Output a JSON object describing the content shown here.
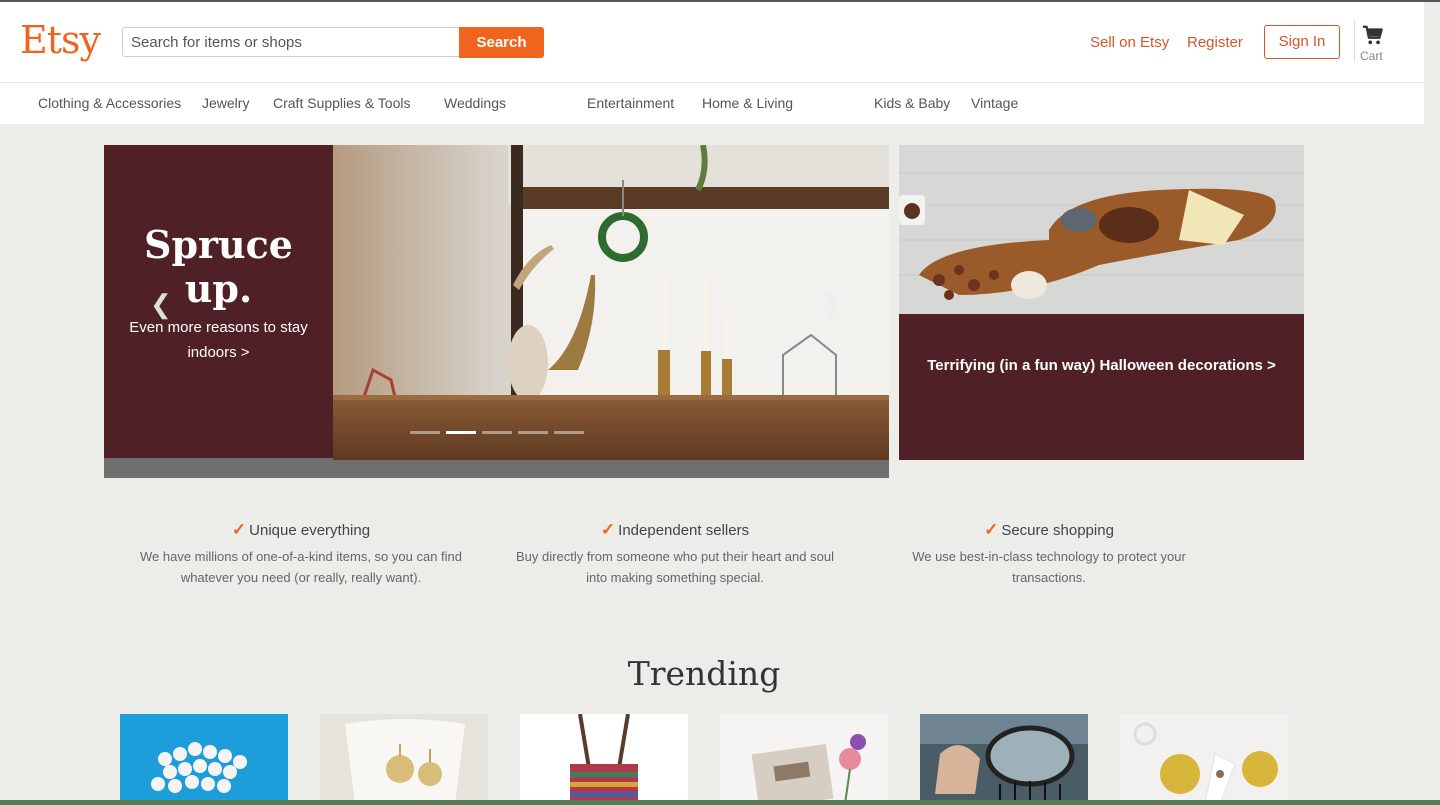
{
  "header": {
    "logo": "Etsy",
    "search_placeholder": "Search for items or shops",
    "search_button": "Search",
    "sell_link": "Sell on Etsy",
    "register_link": "Register",
    "signin_button": "Sign In",
    "cart_label": "Cart"
  },
  "nav": {
    "items": [
      "Clothing & Accessories",
      "Jewelry",
      "Craft Supplies & Tools",
      "Weddings",
      "Entertainment",
      "Home & Living",
      "Kids & Baby",
      "Vintage"
    ]
  },
  "hero": {
    "title": "Spruce up.",
    "subtitle": "Even more reasons to stay indoors >",
    "slides_total": 5,
    "active_slide": 2
  },
  "side_promo": {
    "text": "Terrifying (in a fun way) Halloween decorations >"
  },
  "value_props": [
    {
      "title": "Unique everything",
      "description": "We have millions of one-of-a-kind items, so you can find whatever you need (or really, really want)."
    },
    {
      "title": "Independent sellers",
      "description": "Buy directly from someone who put their heart and soul into making something special."
    },
    {
      "title": "Secure shopping",
      "description": "We use best-in-class technology to protect your transactions."
    }
  ],
  "trending": {
    "title": "Trending"
  },
  "colors": {
    "brand": "#f1641e",
    "hero_panel": "#4f2126",
    "page_bg": "#ecece8"
  }
}
